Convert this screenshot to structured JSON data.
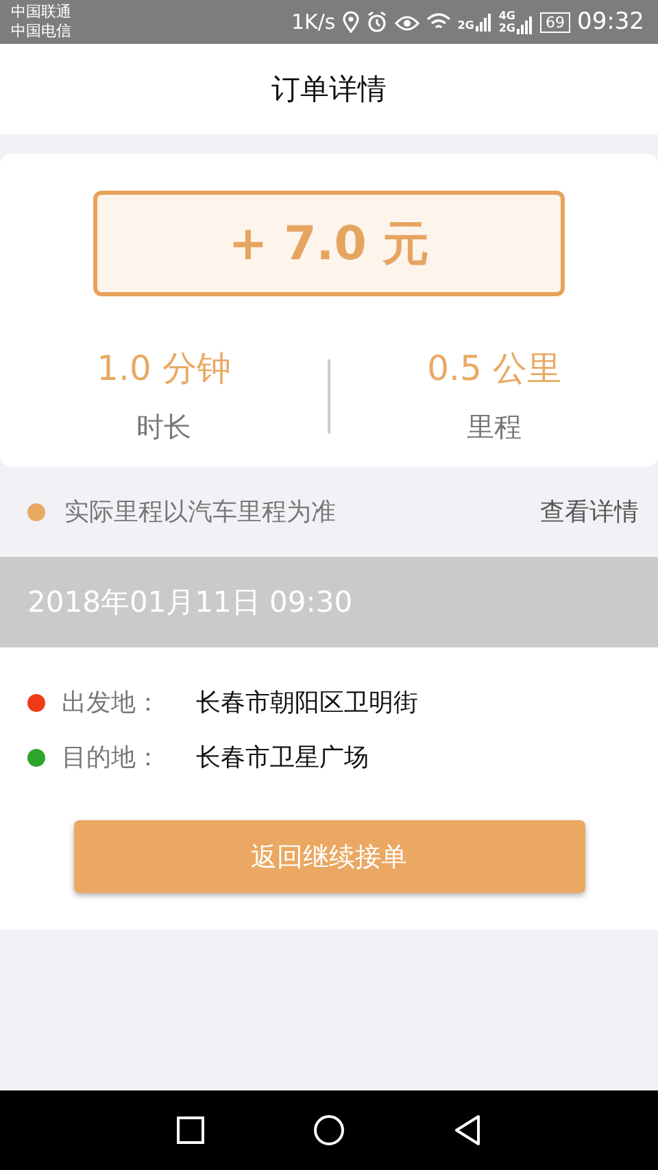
{
  "status_bar": {
    "carriers": [
      "中国联通",
      "中国电信"
    ],
    "speed": "1K/s",
    "sim1_network": "2G",
    "sim2_networks": [
      "4G",
      "2G"
    ],
    "battery": "69",
    "time": "09:32"
  },
  "header": {
    "title": "订单详情"
  },
  "summary": {
    "amount": "+ 7.0 元",
    "stats": [
      {
        "value": "1.0 分钟",
        "label": "时长"
      },
      {
        "value": "0.5 公里",
        "label": "里程"
      }
    ]
  },
  "note": {
    "text": "实际里程以汽车里程为准",
    "color": "#e9a962",
    "link": "查看详情"
  },
  "order": {
    "datetime": "2018年01月11日 09:30",
    "route": [
      {
        "label": "出发地：",
        "place": "长春市朝阳区卫明街",
        "color": "#f03a17"
      },
      {
        "label": "目的地：",
        "place": "长春市卫星广场",
        "color": "#2ea52a"
      }
    ],
    "button": "返回继续接单"
  }
}
